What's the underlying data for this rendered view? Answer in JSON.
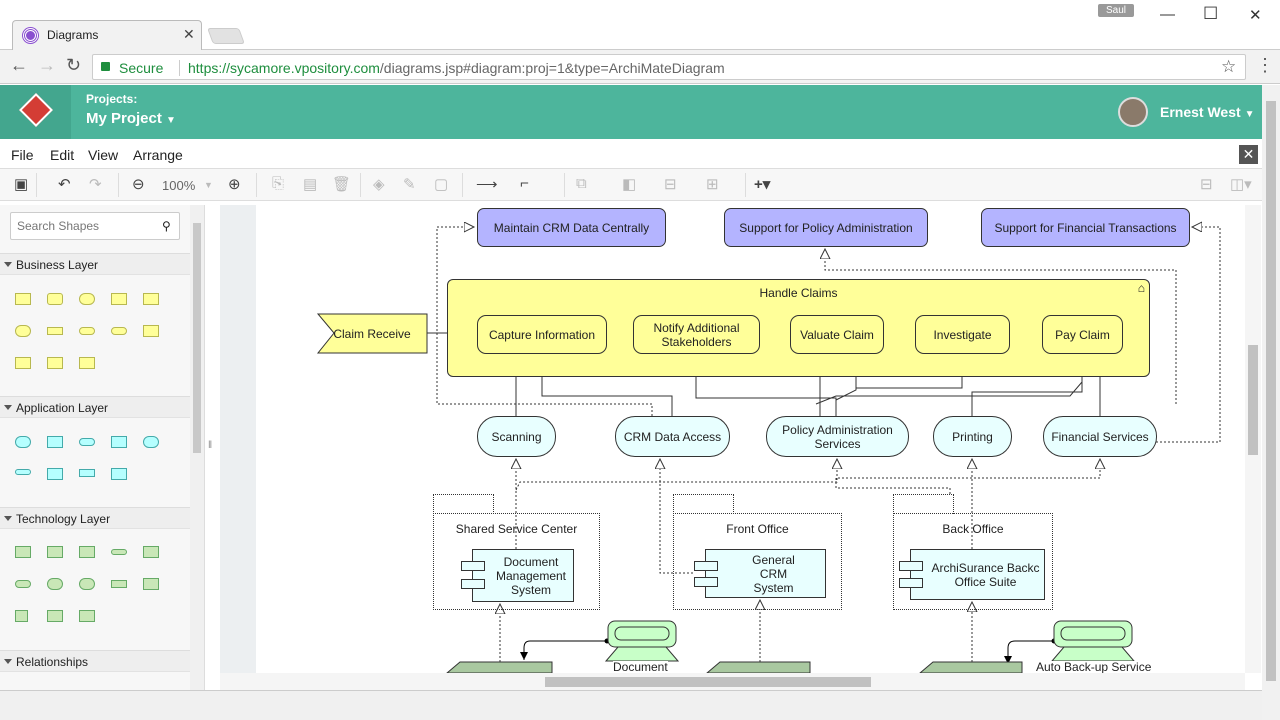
{
  "browser": {
    "tab_title": "Diagrams",
    "user_badge": "Saul",
    "secure_label": "Secure",
    "url_host": "https://sycamore.vpository.com",
    "url_path": "/diagrams.jsp#diagram:proj=1&type=ArchiMateDiagram"
  },
  "app": {
    "projects_label": "Projects:",
    "project_name": "My Project",
    "user_name": "Ernest West",
    "brand_color": "#4db59c"
  },
  "menu": [
    "File",
    "Edit",
    "View",
    "Arrange"
  ],
  "toolbar": {
    "zoom": "100%"
  },
  "left_panel": {
    "search_placeholder": "Search Shapes",
    "sections": [
      "Business Layer",
      "Application Layer",
      "Technology Layer",
      "Relationships"
    ]
  },
  "diagram": {
    "goals": [
      "Maintain CRM Data Centrally",
      "Support for Policy Administration",
      "Support for Financial Transactions"
    ],
    "function": "Handle Claims",
    "event": "Claim Receive",
    "processes": [
      "Capture Information",
      "Notify Additional Stakeholders",
      "Valuate Claim",
      "Investigate",
      "Pay Claim"
    ],
    "services": [
      "Scanning",
      "CRM Data Access",
      "Policy Administration Services",
      "Printing",
      "Financial Services"
    ],
    "groups": [
      "Shared Service Center",
      "Front Office",
      "Back Office"
    ],
    "components": [
      "Document Management System",
      "General CRM System",
      "ArchiSurance Backc Office Suite"
    ],
    "devices": [
      "Document",
      "Auto Back-up Service"
    ]
  }
}
